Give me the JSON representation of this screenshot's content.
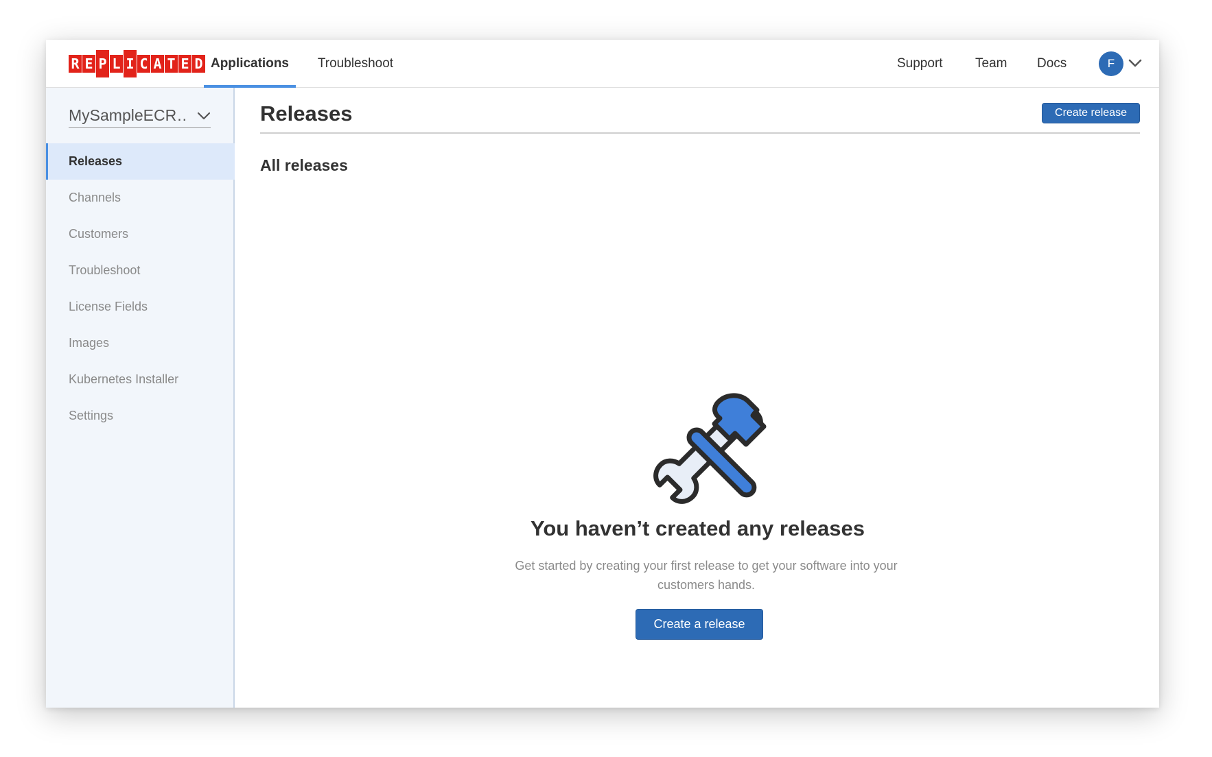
{
  "brand": {
    "logo_letters": [
      "R",
      "E",
      "P",
      "L",
      "I",
      "C",
      "A",
      "T",
      "E",
      "D"
    ],
    "logo_color": "#e2231a"
  },
  "topnav": {
    "tabs": [
      {
        "label": "Applications",
        "active": true
      },
      {
        "label": "Troubleshoot",
        "active": false
      }
    ],
    "right_links": [
      "Support",
      "Team",
      "Docs"
    ],
    "avatar_initial": "F",
    "accent": "#4a90e2"
  },
  "sidebar": {
    "app_selector": "MySampleECR…",
    "items": [
      {
        "label": "Releases",
        "active": true
      },
      {
        "label": "Channels",
        "active": false
      },
      {
        "label": "Customers",
        "active": false
      },
      {
        "label": "Troubleshoot",
        "active": false
      },
      {
        "label": "License Fields",
        "active": false
      },
      {
        "label": "Images",
        "active": false
      },
      {
        "label": "Kubernetes Installer",
        "active": false
      },
      {
        "label": "Settings",
        "active": false
      }
    ]
  },
  "main": {
    "title": "Releases",
    "create_button": "Create release",
    "section_title": "All releases",
    "empty_state": {
      "icon": "wrench-hammer-icon",
      "title": "You haven’t created any releases",
      "description": "Get started by creating your first release to get your software into your customers hands.",
      "button": "Create a release"
    },
    "button_color": "#2d6bb5"
  }
}
